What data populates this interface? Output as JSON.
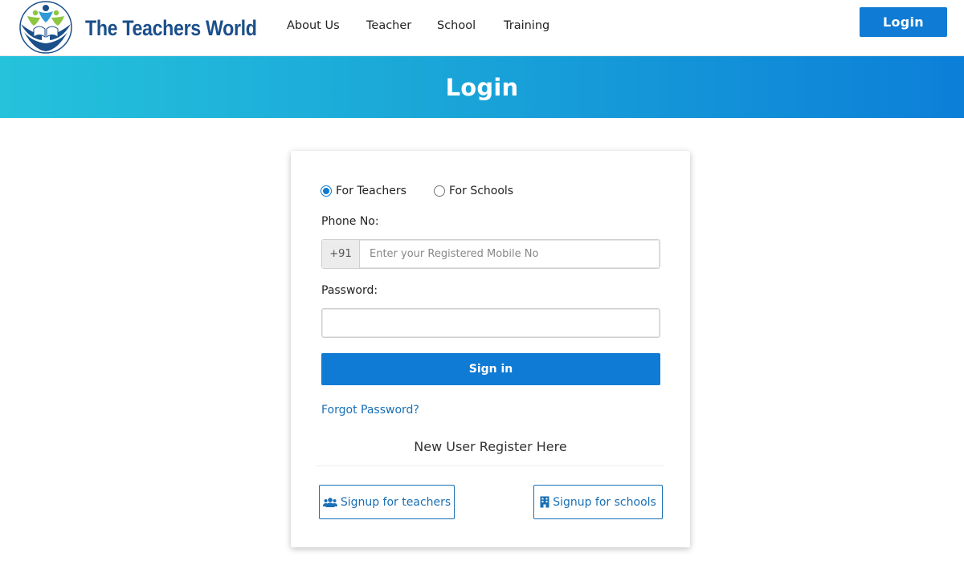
{
  "header": {
    "brand": "The Teachers World",
    "logo_icon": "teachers-world-logo",
    "nav": [
      "About Us",
      "Teacher",
      "School",
      "Training"
    ],
    "login_label": "Login",
    "accent": "#0f7bd4",
    "brand_color": "#1b4f8a"
  },
  "banner": {
    "title": "Login"
  },
  "form": {
    "radios": [
      {
        "label": "For Teachers",
        "checked": true
      },
      {
        "label": "For Schools",
        "checked": false
      }
    ],
    "phone_label": "Phone No:",
    "phone_prefix": "+91",
    "phone_placeholder": "Enter your Registered Mobile No",
    "phone_value": "",
    "password_label": "Password:",
    "password_value": "",
    "signin_label": "Sign in",
    "forgot_label": "Forgot Password?",
    "register_heading": "New User Register Here",
    "signup_teachers": {
      "label": "Signup for teachers",
      "icon": "users-icon"
    },
    "signup_schools": {
      "label": "Signup for schools",
      "icon": "building-icon"
    }
  }
}
